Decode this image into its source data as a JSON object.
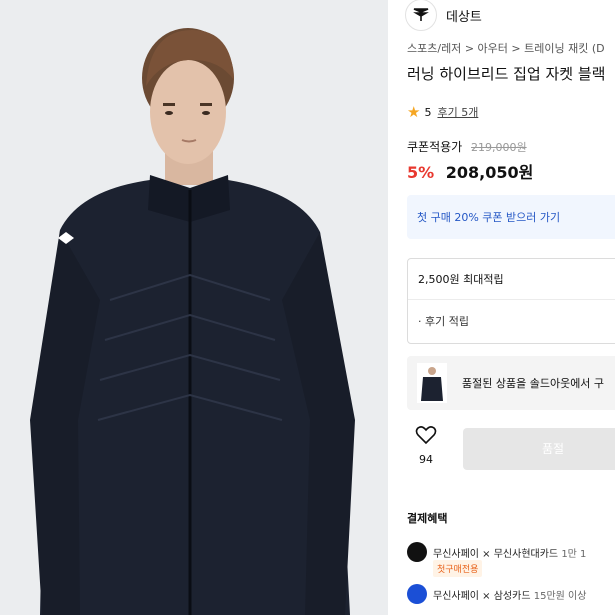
{
  "brand": {
    "name": "데상트",
    "logo_icon": "descente-logo-icon"
  },
  "breadcrumb": [
    "스포츠/레저",
    "아우터",
    "트레이닝 재킷 (D"
  ],
  "breadcrumb_sep": ">",
  "product": {
    "title": "러닝 하이브리드 집업 자켓 블랙",
    "rating": "5",
    "reviews_label": "후기 5개",
    "coupon_price_label": "쿠폰적용가",
    "original_price": "219,000원",
    "discount": "5%",
    "price": "208,050원"
  },
  "coupon_banner": "첫 구매 20% 쿠폰 받으러 가기",
  "points": {
    "max_label": "2,500원 최대적립",
    "review_label": "· 후기 적립"
  },
  "soldout": {
    "text": "품절된 상품을 솔드아웃에서 구"
  },
  "like": {
    "count": "94",
    "icon": "heart-icon"
  },
  "buy_button": "품절",
  "payment": {
    "title": "결제혜택",
    "rows": [
      {
        "icon": "musinsa-pay-icon",
        "text": "무신사페이 × 무신사현대카드",
        "detail": " 1만 1",
        "badge": "첫구매전용",
        "color": "#111111"
      },
      {
        "icon": "samsung-card-icon",
        "text": "무신사페이 × 삼성카드",
        "detail": " 15만원 이상",
        "color": "#1b4fd6"
      }
    ]
  },
  "colors": {
    "discount": "#e8382f",
    "coupon_blue": "#2457c5",
    "star": "#f5a623"
  }
}
